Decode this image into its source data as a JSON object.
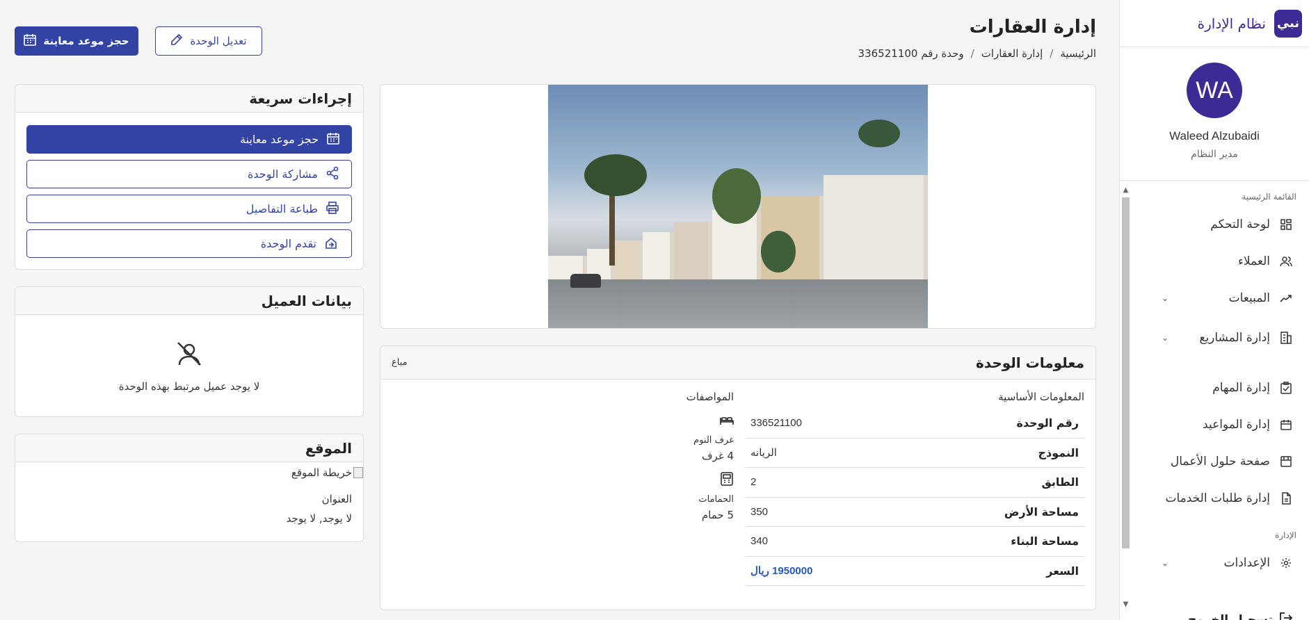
{
  "brand": {
    "logo_text": "نبي",
    "name": "نظام الإدارة"
  },
  "profile": {
    "initials": "WA",
    "name": "Waleed Alzubaidi",
    "role": "مدير النظام"
  },
  "menu": {
    "section_main": "القائمة الرئيسية",
    "items": [
      {
        "label": "لوحة التحكم",
        "icon": "dashboard-icon"
      },
      {
        "label": "العملاء",
        "icon": "users-icon"
      },
      {
        "label": "المبيعات",
        "icon": "trending-up-icon",
        "expandable": true
      },
      {
        "label": "إدارة المشاريع",
        "icon": "building-icon",
        "expandable": true
      },
      {
        "label": "إدارة المهام",
        "icon": "tasks-icon"
      },
      {
        "label": "إدارة المواعيد",
        "icon": "calendar-icon"
      },
      {
        "label": "صفحة حلول الأعمال",
        "icon": "store-icon"
      },
      {
        "label": "إدارة طلبات الخدمات",
        "icon": "service-icon"
      }
    ],
    "section_admin": "الإدارة",
    "settings": {
      "label": "الإعدادات",
      "icon": "gear-icon"
    },
    "logout": "تسجيل الخروج"
  },
  "header": {
    "title": "إدارة العقارات",
    "breadcrumb": [
      "الرئيسية",
      "إدارة العقارات",
      "وحدة رقم 336521100"
    ],
    "book_button": "حجز موعد معاينة",
    "edit_button": "تعديل الوحدة"
  },
  "unit": {
    "title": "معلومات الوحدة",
    "status": "مباع",
    "basic_title": "المعلومات الأساسية",
    "rows": [
      {
        "label": "رقم الوحدة",
        "value": "336521100"
      },
      {
        "label": "النموذج",
        "value": "الريانه"
      },
      {
        "label": "الطابق",
        "value": "2"
      },
      {
        "label": "مساحة الأرض",
        "value": "350"
      },
      {
        "label": "مساحة البناء",
        "value": "340"
      },
      {
        "label": "السعر",
        "value": "1950000 ريال"
      }
    ],
    "specs_title": "المواصفات",
    "bedrooms_label": "غرف النوم",
    "bedrooms_value": "4 غرف",
    "bathrooms_label": "الحمامات",
    "bathrooms_value": "5 حمام"
  },
  "quick_actions": {
    "title": "إجراءات سريعة",
    "book": "حجز موعد معاينة",
    "share": "مشاركة الوحدة",
    "print": "طباعة التفاصيل",
    "progress": "تقدم الوحدة"
  },
  "client": {
    "title": "بيانات العميل",
    "empty": "لا يوجد عميل مرتبط بهذه الوحدة"
  },
  "location": {
    "title": "الموقع",
    "map_alt": "خريطة الموقع",
    "address_label": "العنوان",
    "address_value": "لا يوجد, لا يوجد"
  },
  "colors": {
    "primary": "#3343a4",
    "brand": "#3d2a94",
    "price": "#2858b8"
  }
}
